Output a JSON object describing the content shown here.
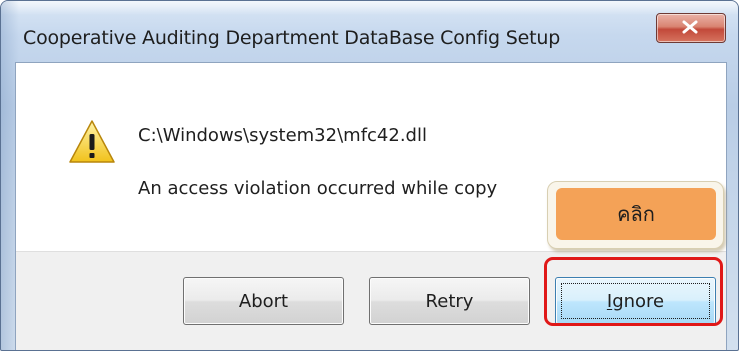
{
  "window": {
    "title": "Cooperative Auditing Department DataBase Config Setup",
    "close_icon": "close-x-icon"
  },
  "dialog": {
    "icon": "warning-triangle-icon",
    "file_path": "C:\\Windows\\system32\\mfc42.dll",
    "message": "An access violation occurred while copy"
  },
  "buttons": {
    "abort_label": "Abort",
    "retry_label": "Retry",
    "ignore_prefix": "",
    "ignore_mnemonic": "I",
    "ignore_rest": "gnore"
  },
  "annotation": {
    "callout_label": "คลิก",
    "callout_color": "#f4a257",
    "highlight_color": "#e01818"
  }
}
